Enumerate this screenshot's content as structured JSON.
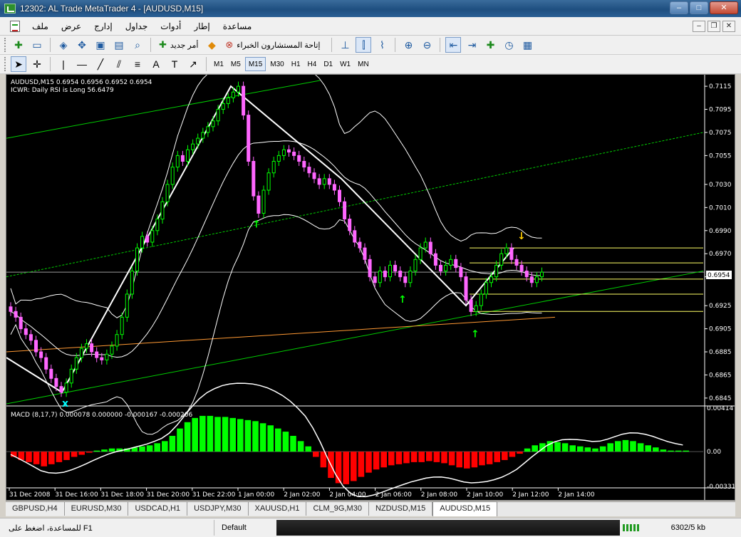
{
  "window": {
    "title": "12302: AL Trade MetaTrader 4 - [AUDUSD,M15]",
    "buttons": [
      "–",
      "□",
      "✕"
    ]
  },
  "menu": {
    "items": [
      "ملف",
      "عرض",
      "إدارج",
      "جداول",
      "أدوات",
      "إطار",
      "مساعدة"
    ],
    "mdi_buttons": [
      "–",
      "❐",
      "✕"
    ]
  },
  "toolbar1": {
    "new_order_label": "أمر جديد",
    "experts_label": "إتاحة المستشارون الخبراء"
  },
  "toolbar2": {
    "timeframes": [
      "M1",
      "M5",
      "M15",
      "M30",
      "H1",
      "H4",
      "D1",
      "W1",
      "MN"
    ],
    "active_timeframe": "M15"
  },
  "chart": {
    "symbol_label": "AUDUSD,M15  0.6954 0.6956 0.6952 0.6954",
    "indicator_label": "ICWR: Daily RSI is Long 56.6479",
    "macd_label": "MACD (8,17,7) 0.000078 0.000000 -0.000167 -0.000206",
    "current_price": "0.6954",
    "price_ticks": [
      "0.7115",
      "0.7095",
      "0.7075",
      "0.7055",
      "0.7030",
      "0.7010",
      "0.6990",
      "0.6970",
      "0.6950",
      "0.6925",
      "0.6905",
      "0.6885",
      "0.6865",
      "0.6845"
    ],
    "macd_ticks": [
      "0.00414",
      "0.00",
      "-0.00331"
    ],
    "time_ticks": [
      "31 Dec 2008",
      "31 Dec 16:00",
      "31 Dec 18:00",
      "31 Dec 20:00",
      "31 Dec 22:00",
      "1 Jan 00:00",
      "2 Jan 02:00",
      "2 Jan 04:00",
      "2 Jan 06:00",
      "2 Jan 08:00",
      "2 Jan 10:00",
      "2 Jan 12:00",
      "2 Jan 14:00"
    ],
    "colors": {
      "bull": "#00ff00",
      "bear": "#ff66ff",
      "bb": "#ffffff",
      "channel": "#00cc00",
      "fib": "#ffff66",
      "macd_pos": "#00ff00",
      "macd_neg": "#ff0000"
    }
  },
  "chart_data": {
    "type": "candlestick",
    "closes": [
      0.692,
      0.6915,
      0.6905,
      0.69,
      0.6895,
      0.6885,
      0.688,
      0.687,
      0.6862,
      0.6855,
      0.685,
      0.6858,
      0.687,
      0.688,
      0.6888,
      0.6892,
      0.6885,
      0.688,
      0.6878,
      0.6883,
      0.689,
      0.69,
      0.6915,
      0.6935,
      0.6955,
      0.6975,
      0.6985,
      0.698,
      0.699,
      0.7,
      0.7015,
      0.703,
      0.7045,
      0.7055,
      0.705,
      0.706,
      0.7065,
      0.707,
      0.7075,
      0.708,
      0.7085,
      0.7095,
      0.71,
      0.7105,
      0.711,
      0.7115,
      0.709,
      0.705,
      0.702,
      0.7005,
      0.7025,
      0.704,
      0.705,
      0.7055,
      0.706,
      0.7058,
      0.7055,
      0.705,
      0.7045,
      0.704,
      0.7035,
      0.703,
      0.7035,
      0.703,
      0.7025,
      0.7015,
      0.7,
      0.699,
      0.698,
      0.6975,
      0.6965,
      0.695,
      0.6945,
      0.6955,
      0.695,
      0.696,
      0.6955,
      0.695,
      0.6945,
      0.6955,
      0.6965,
      0.6975,
      0.698,
      0.697,
      0.696,
      0.6955,
      0.696,
      0.6965,
      0.6958,
      0.695,
      0.693,
      0.692,
      0.6925,
      0.6935,
      0.6945,
      0.695,
      0.696,
      0.697,
      0.6975,
      0.6965,
      0.696,
      0.6955,
      0.695,
      0.6945,
      0.695,
      0.6954
    ],
    "macd_hist": [
      -0.0005,
      -0.0008,
      -0.001,
      -0.0012,
      -0.0014,
      -0.0012,
      -0.001,
      -0.0008,
      -0.0005,
      -0.0003,
      -0.0001,
      0.0001,
      0.0002,
      0.0003,
      0.0003,
      0.0003,
      0.0004,
      0.0005,
      0.0006,
      0.0008,
      0.001,
      0.0015,
      0.0022,
      0.0028,
      0.0032,
      0.0034,
      0.0034,
      0.0033,
      0.0033,
      0.0032,
      0.0031,
      0.003,
      0.0029,
      0.0027,
      0.0025,
      0.0022,
      0.0019,
      0.0015,
      0.001,
      0.0005,
      -0.0005,
      -0.0015,
      -0.0025,
      -0.003,
      -0.0031,
      -0.0028,
      -0.0024,
      -0.002,
      -0.0017,
      -0.0015,
      -0.0013,
      -0.0012,
      -0.0011,
      -0.001,
      -0.001,
      -0.0009,
      -0.001,
      -0.0011,
      -0.0013,
      -0.0015,
      -0.0016,
      -0.0015,
      -0.0013,
      -0.0012,
      -0.001,
      -0.0008,
      -0.0005,
      -0.0002,
      0.0003,
      0.0006,
      0.0008,
      0.001,
      0.0009,
      0.0008,
      0.0006,
      0.0005,
      0.0004,
      0.0003,
      0.0005,
      0.0008,
      0.001,
      0.0011,
      0.001,
      0.0008,
      0.0006,
      0.0004,
      0.0002,
      0.0001,
      0.0001,
      0.0001
    ],
    "ylim": [
      0.684,
      0.712
    ],
    "macd_ylim": [
      -0.00331,
      0.00414
    ]
  },
  "tabs": [
    "GBPUSD,H4",
    "EURUSD,M30",
    "USDCAD,H1",
    "USDJPY,M30",
    "XAUUSD,H1",
    "CLM_9G,M30",
    "NZDUSD,M15",
    "AUDUSD,M15"
  ],
  "active_tab": "AUDUSD,M15",
  "status": {
    "help": "للمساعدة، اضغط على F1",
    "profile": "Default",
    "traffic": "6302/5 kb"
  }
}
